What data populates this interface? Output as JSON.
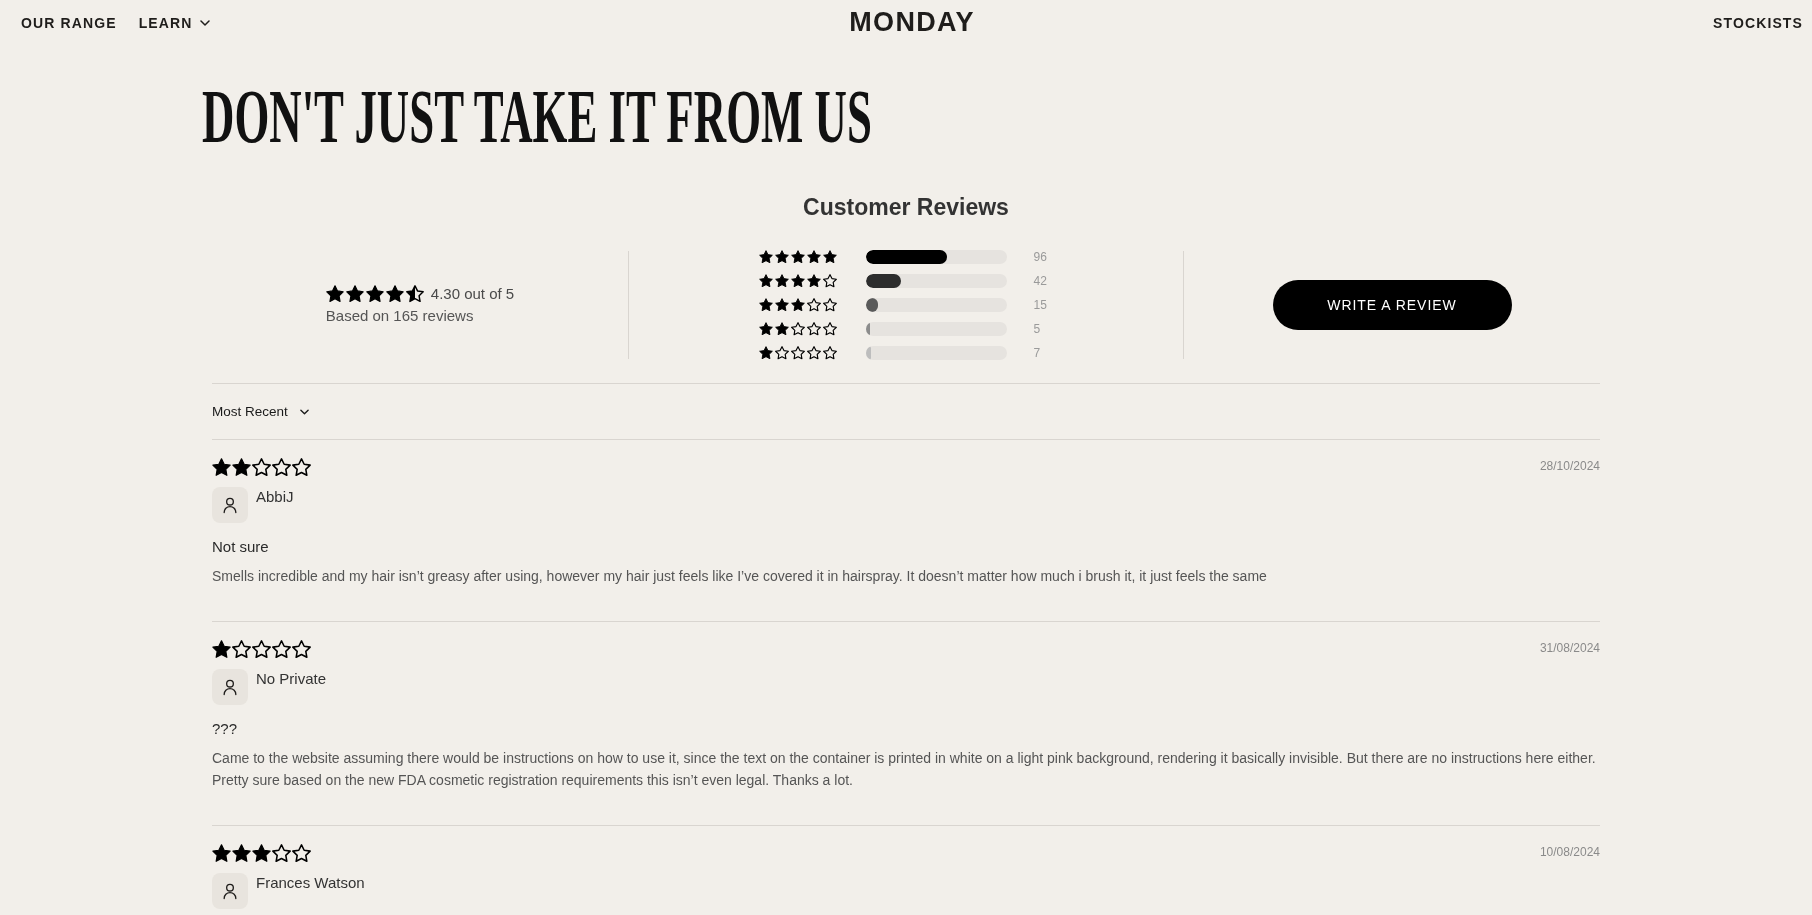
{
  "header": {
    "nav_left": [
      {
        "label": "OUR RANGE",
        "kind": "link"
      },
      {
        "label": "LEARN",
        "kind": "dropdown"
      }
    ],
    "logo": "MONDAY",
    "nav_right": [
      {
        "label": "STOCKISTS",
        "kind": "link"
      }
    ]
  },
  "heading": "DON'T JUST TAKE IT FROM US",
  "reviews": {
    "title": "Customer Reviews",
    "summary": {
      "stars": 4.5,
      "average": "4.30 out of 5",
      "based_on": "Based on 165 reviews"
    },
    "histogram": [
      {
        "stars": 5,
        "level": 0.58,
        "count": "96",
        "color": "#000000"
      },
      {
        "stars": 4,
        "level": 0.255,
        "count": "42",
        "color": "#2d2d2d"
      },
      {
        "stars": 3,
        "level": 0.091,
        "count": "15",
        "color": "#5a5a5a"
      },
      {
        "stars": 2,
        "level": 0.03,
        "count": "5",
        "color": "#8c8c8c"
      },
      {
        "stars": 1,
        "level": 0.042,
        "count": "7",
        "color": "#bdbdbd"
      }
    ],
    "write_button": "WRITE A REVIEW",
    "sort": {
      "label": "Most Recent"
    },
    "items": [
      {
        "stars": 2,
        "date": "28/10/2024",
        "author": "AbbiJ",
        "title": "Not sure",
        "body": "Smells incredible and my hair isn’t greasy after using, however my hair just feels like I’ve covered it in hairspray. It doesn’t matter how much i brush it, it just feels the same"
      },
      {
        "stars": 1,
        "date": "31/08/2024",
        "author": "No Private",
        "title": "???",
        "body": "Came to the website assuming there would be instructions on how to use it, since the text on the container is printed in white on a light pink background, rendering it basically invisible. But there are no instructions here either. Pretty sure based on the new FDA cosmetic registration requirements this isn’t even legal. Thanks a lot."
      },
      {
        "stars": 3,
        "date": "10/08/2024",
        "author": "Frances Watson"
      }
    ]
  }
}
